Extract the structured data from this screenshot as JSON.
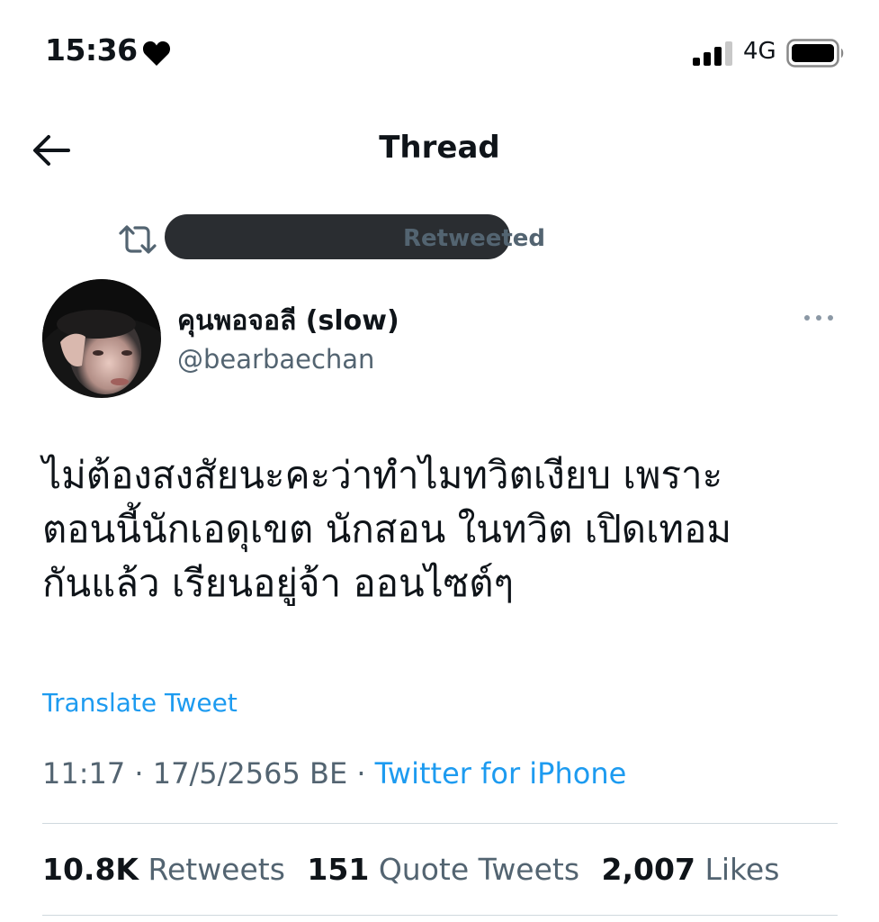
{
  "status_bar": {
    "time": "15:36",
    "network": "4G"
  },
  "nav": {
    "title": "Thread"
  },
  "retweet": {
    "label": "Retweeted"
  },
  "tweet": {
    "display_name": "คุนพอจอลี (slow)",
    "handle": "@bearbaechan",
    "text_lines": [
      "ไม่ต้องสงสัยนะคะว่าทำไมทวิตเงียบ เพราะ",
      "ตอนนี้นักเอดุเขต นักสอน ในทวิต เปิดเทอม",
      "กันแล้ว เรียนอยู่จ้า ออนไซต์ๆ"
    ],
    "translate_label": "Translate Tweet",
    "time": "11:17",
    "separator": "·",
    "date": "17/5/2565 BE",
    "source": "Twitter for iPhone"
  },
  "stats": {
    "retweets_count": "10.8K",
    "retweets_label": "Retweets",
    "quotes_count": "151",
    "quotes_label": "Quote Tweets",
    "likes_count": "2,007",
    "likes_label": "Likes"
  },
  "colors": {
    "link": "#1d9bf0",
    "secondary_text": "#536471",
    "divider": "#cfd9de"
  }
}
